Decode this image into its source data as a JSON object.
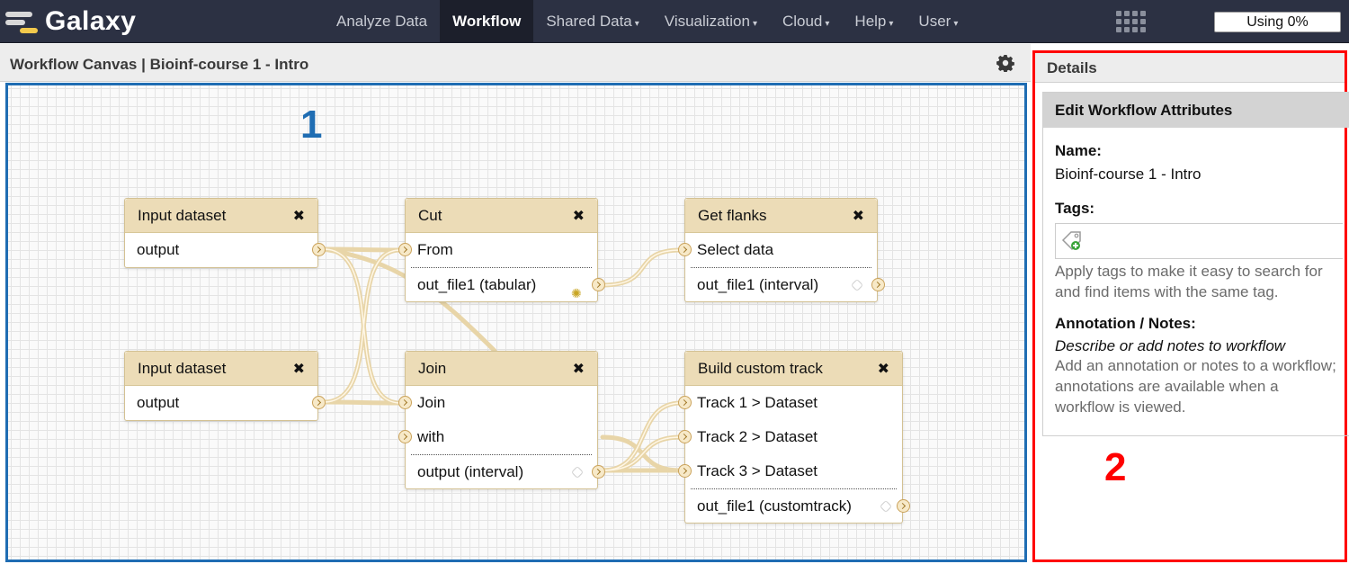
{
  "brand": {
    "name": "Galaxy"
  },
  "nav": {
    "items": [
      {
        "label": "Analyze Data",
        "dropdown": false,
        "active": false
      },
      {
        "label": "Workflow",
        "dropdown": false,
        "active": true
      },
      {
        "label": "Shared Data",
        "dropdown": true,
        "active": false
      },
      {
        "label": "Visualization",
        "dropdown": true,
        "active": false
      },
      {
        "label": "Cloud",
        "dropdown": true,
        "active": false
      },
      {
        "label": "Help",
        "dropdown": true,
        "active": false
      },
      {
        "label": "User",
        "dropdown": true,
        "active": false
      }
    ],
    "caret": "▾"
  },
  "quota": {
    "label": "Using 0%"
  },
  "canvas": {
    "title": "Workflow Canvas | Bioinf-course 1 - Intro",
    "callout": "1",
    "nodes": {
      "input1": {
        "title": "Input dataset",
        "outputs": [
          "output"
        ]
      },
      "input2": {
        "title": "Input dataset",
        "outputs": [
          "output"
        ]
      },
      "cut": {
        "title": "Cut",
        "inputs": [
          "From"
        ],
        "outputs": [
          "out_file1 (tabular)"
        ]
      },
      "flanks": {
        "title": "Get flanks",
        "inputs": [
          "Select data"
        ],
        "outputs": [
          "out_file1 (interval)"
        ]
      },
      "join": {
        "title": "Join",
        "inputs": [
          "Join",
          "with"
        ],
        "outputs": [
          "output (interval)"
        ]
      },
      "track": {
        "title": "Build custom track",
        "inputs": [
          "Track 1 > Dataset",
          "Track 2 > Dataset",
          "Track 3 > Dataset"
        ],
        "outputs": [
          "out_file1 (customtrack)"
        ]
      }
    },
    "close_glyph": "✖"
  },
  "details": {
    "header": "Details",
    "panel_title": "Edit Workflow Attributes",
    "name_label": "Name:",
    "name_value": "Bioinf-course 1 - Intro",
    "tags_label": "Tags:",
    "tags_help": "Apply tags to make it easy to search for and find items with the same tag.",
    "annotation_label": "Annotation / Notes:",
    "annotation_placeholder": "Describe or add notes to workflow",
    "annotation_help": "Add an annotation or notes to a workflow; annotations are available when a workflow is viewed.",
    "callout": "2"
  },
  "colors": {
    "canvas_border": "#1f6db3",
    "details_border": "#ff0000",
    "node_header": "#ecdcb7",
    "wire": "#e8d5a8"
  }
}
